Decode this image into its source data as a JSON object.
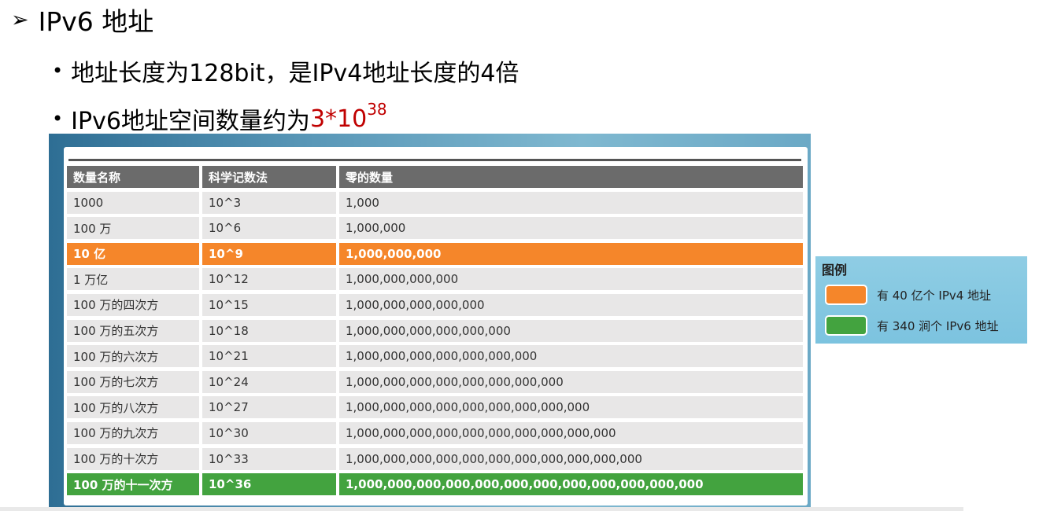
{
  "heading": {
    "bullet": "➢",
    "text": "IPv6 地址"
  },
  "bullets": [
    {
      "marker": "•",
      "text": "地址长度为128bit，是IPv4地址长度的4倍"
    },
    {
      "marker": "•",
      "prefix": "IPv6地址空间数量约为",
      "highlight": "3*10",
      "superscript": "38"
    }
  ],
  "table": {
    "headers": [
      "数量名称",
      "科学记数法",
      "零的数量"
    ],
    "rows": [
      {
        "name": "1000",
        "sci": "10^3",
        "zeros": "1,000",
        "style": "normal"
      },
      {
        "name": "100 万",
        "sci": "10^6",
        "zeros": "1,000,000",
        "style": "normal"
      },
      {
        "name": "10 亿",
        "sci": "10^9",
        "zeros": "1,000,000,000",
        "style": "orange"
      },
      {
        "name": "1 万亿",
        "sci": "10^12",
        "zeros": "1,000,000,000,000",
        "style": "normal"
      },
      {
        "name": "100 万的四次方",
        "sci": "10^15",
        "zeros": "1,000,000,000,000,000",
        "style": "normal"
      },
      {
        "name": "100 万的五次方",
        "sci": "10^18",
        "zeros": "1,000,000,000,000,000,000",
        "style": "normal"
      },
      {
        "name": "100 万的六次方",
        "sci": "10^21",
        "zeros": "1,000,000,000,000,000,000,000",
        "style": "normal"
      },
      {
        "name": "100 万的七次方",
        "sci": "10^24",
        "zeros": "1,000,000,000,000,000,000,000,000",
        "style": "normal"
      },
      {
        "name": "100 万的八次方",
        "sci": "10^27",
        "zeros": "1,000,000,000,000,000,000,000,000,000",
        "style": "normal"
      },
      {
        "name": "100 万的九次方",
        "sci": "10^30",
        "zeros": "1,000,000,000,000,000,000,000,000,000,000",
        "style": "normal"
      },
      {
        "name": "100 万的十次方",
        "sci": "10^33",
        "zeros": "1,000,000,000,000,000,000,000,000,000,000,000",
        "style": "normal"
      },
      {
        "name": "100 万的十一次方",
        "sci": "10^36",
        "zeros": "1,000,000,000,000,000,000,000,000,000,000,000,000",
        "style": "green"
      }
    ]
  },
  "legend": {
    "title": "图例",
    "items": [
      {
        "label": "有 40 亿个 IPv4 地址",
        "color": "#f5862a"
      },
      {
        "label": "有 340 涧个 IPv6 地址",
        "color": "#43a33f"
      }
    ]
  },
  "colors": {
    "highlight": "#c00000",
    "header": "#6b6b6b",
    "orange": "#f5862a",
    "green": "#43a33f"
  }
}
